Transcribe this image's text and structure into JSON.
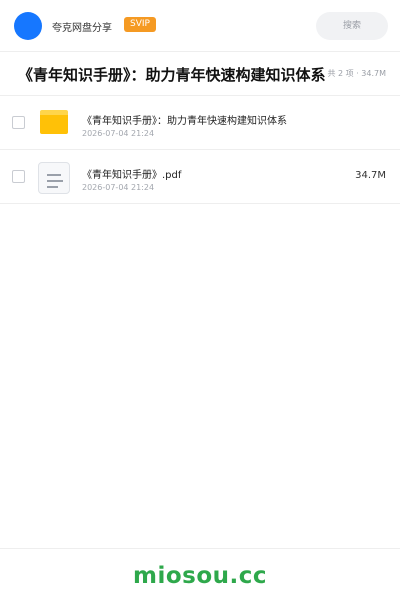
{
  "header": {
    "share_name": "夸克网盘分享",
    "badge": "SVIP",
    "search_label": "搜索",
    "avatar_color": "#1677ff",
    "badge_color": "#f59a23"
  },
  "title_bar": {
    "title": "《青年知识手册》：助力青年快速构建知识体系",
    "summary": "共 2 项 · 34.7M"
  },
  "items": [
    {
      "type_icon": "folder-icon",
      "name": "《青年知识手册》：助力青年快速构建知识体系",
      "date": "2026-07-04 21:24",
      "size": ""
    },
    {
      "type_icon": "document-icon",
      "name": "《青年知识手册》.pdf",
      "date": "2026-07-04 21:24",
      "size": "34.7M"
    }
  ],
  "footer": {
    "watermark": "miosou.cc",
    "watermark_color": "#2ea84b"
  }
}
